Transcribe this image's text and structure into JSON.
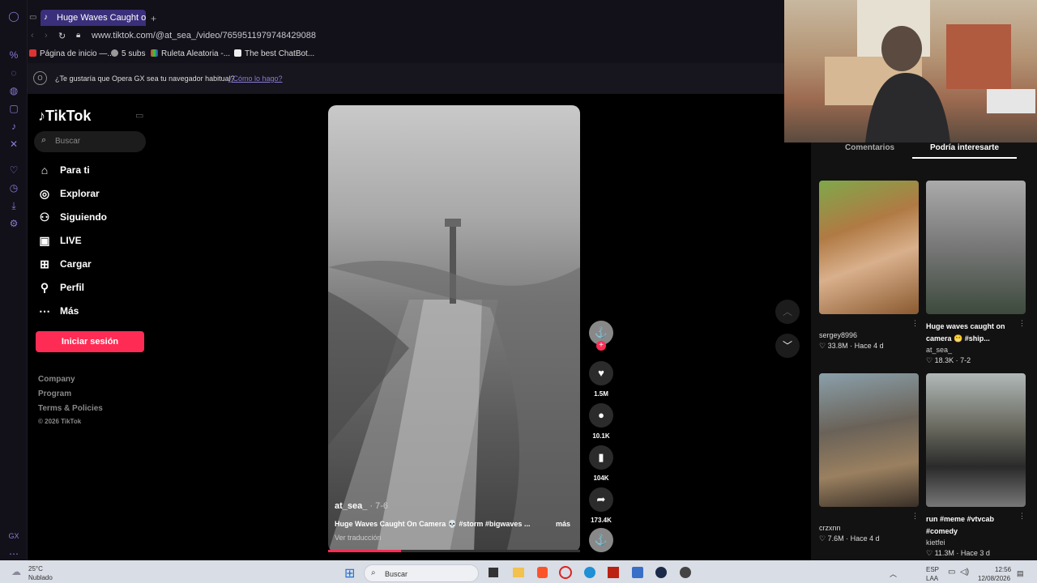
{
  "browser": {
    "tab_title": "Huge Waves Caught on",
    "new_tab": "+",
    "url": "www.tiktok.com/@at_sea_/video/7659511979748429088",
    "bookmarks": [
      "Página de inicio —...",
      "5 subs",
      "Ruleta Aleatoria -...",
      "The best ChatBot..."
    ],
    "notice": "¿Te gustaría que Opera GX sea tu navegador habitual?",
    "notice_link": "¿Cómo lo hago?",
    "sidebar_icons": [
      "percent-icon",
      "whatsapp-icon",
      "discord-icon",
      "instagram-icon",
      "tiktok-icon",
      "x-icon",
      "heart-icon",
      "history-icon",
      "download-icon",
      "settings-icon",
      "gx-icon",
      "more-icon"
    ]
  },
  "tiktok": {
    "logo": "TikTok",
    "search_placeholder": "Buscar",
    "nav": [
      "Para ti",
      "Explorar",
      "Siguiendo",
      "LIVE",
      "Cargar",
      "Perfil",
      "Más"
    ],
    "login": "Iniciar sesión",
    "footer": [
      "Company",
      "Program",
      "Terms & Policies",
      "© 2026 TikTok"
    ]
  },
  "video": {
    "author": "at_sea_",
    "date": " · 7-6",
    "caption": "Huge Waves Caught On Camera 💀 #storm #bigwaves ...",
    "more": "más",
    "translate": "Ver traducción",
    "progress": 0.29,
    "likes": "1.5M",
    "comments": "10.1K",
    "saves": "104K",
    "shares": "173.4K"
  },
  "panel": {
    "tab_comments": "Comentarios",
    "tab_interest": "Podría interesarte",
    "items": [
      {
        "title": "",
        "author": "sergey8996",
        "stats": "♡ 33.8M · Hace 4 d"
      },
      {
        "title": "Huge waves caught on camera 😬 #ship...",
        "author": "at_sea_",
        "stats": "♡ 18.3K · 7-2"
      },
      {
        "title": "",
        "author": "crzxnn",
        "stats": "♡ 7.6M · Hace 4 d"
      },
      {
        "title": "run #meme #vtvcab #comedy",
        "author": "kietfei",
        "stats": "♡ 11.3M · Hace 3 d"
      }
    ]
  },
  "taskbar": {
    "weather_temp": "25°C",
    "weather_desc": "Nublado",
    "search": "Buscar",
    "lang1": "ESP",
    "lang2": "LAA",
    "time": "12:56",
    "date": "12/08/2026"
  }
}
